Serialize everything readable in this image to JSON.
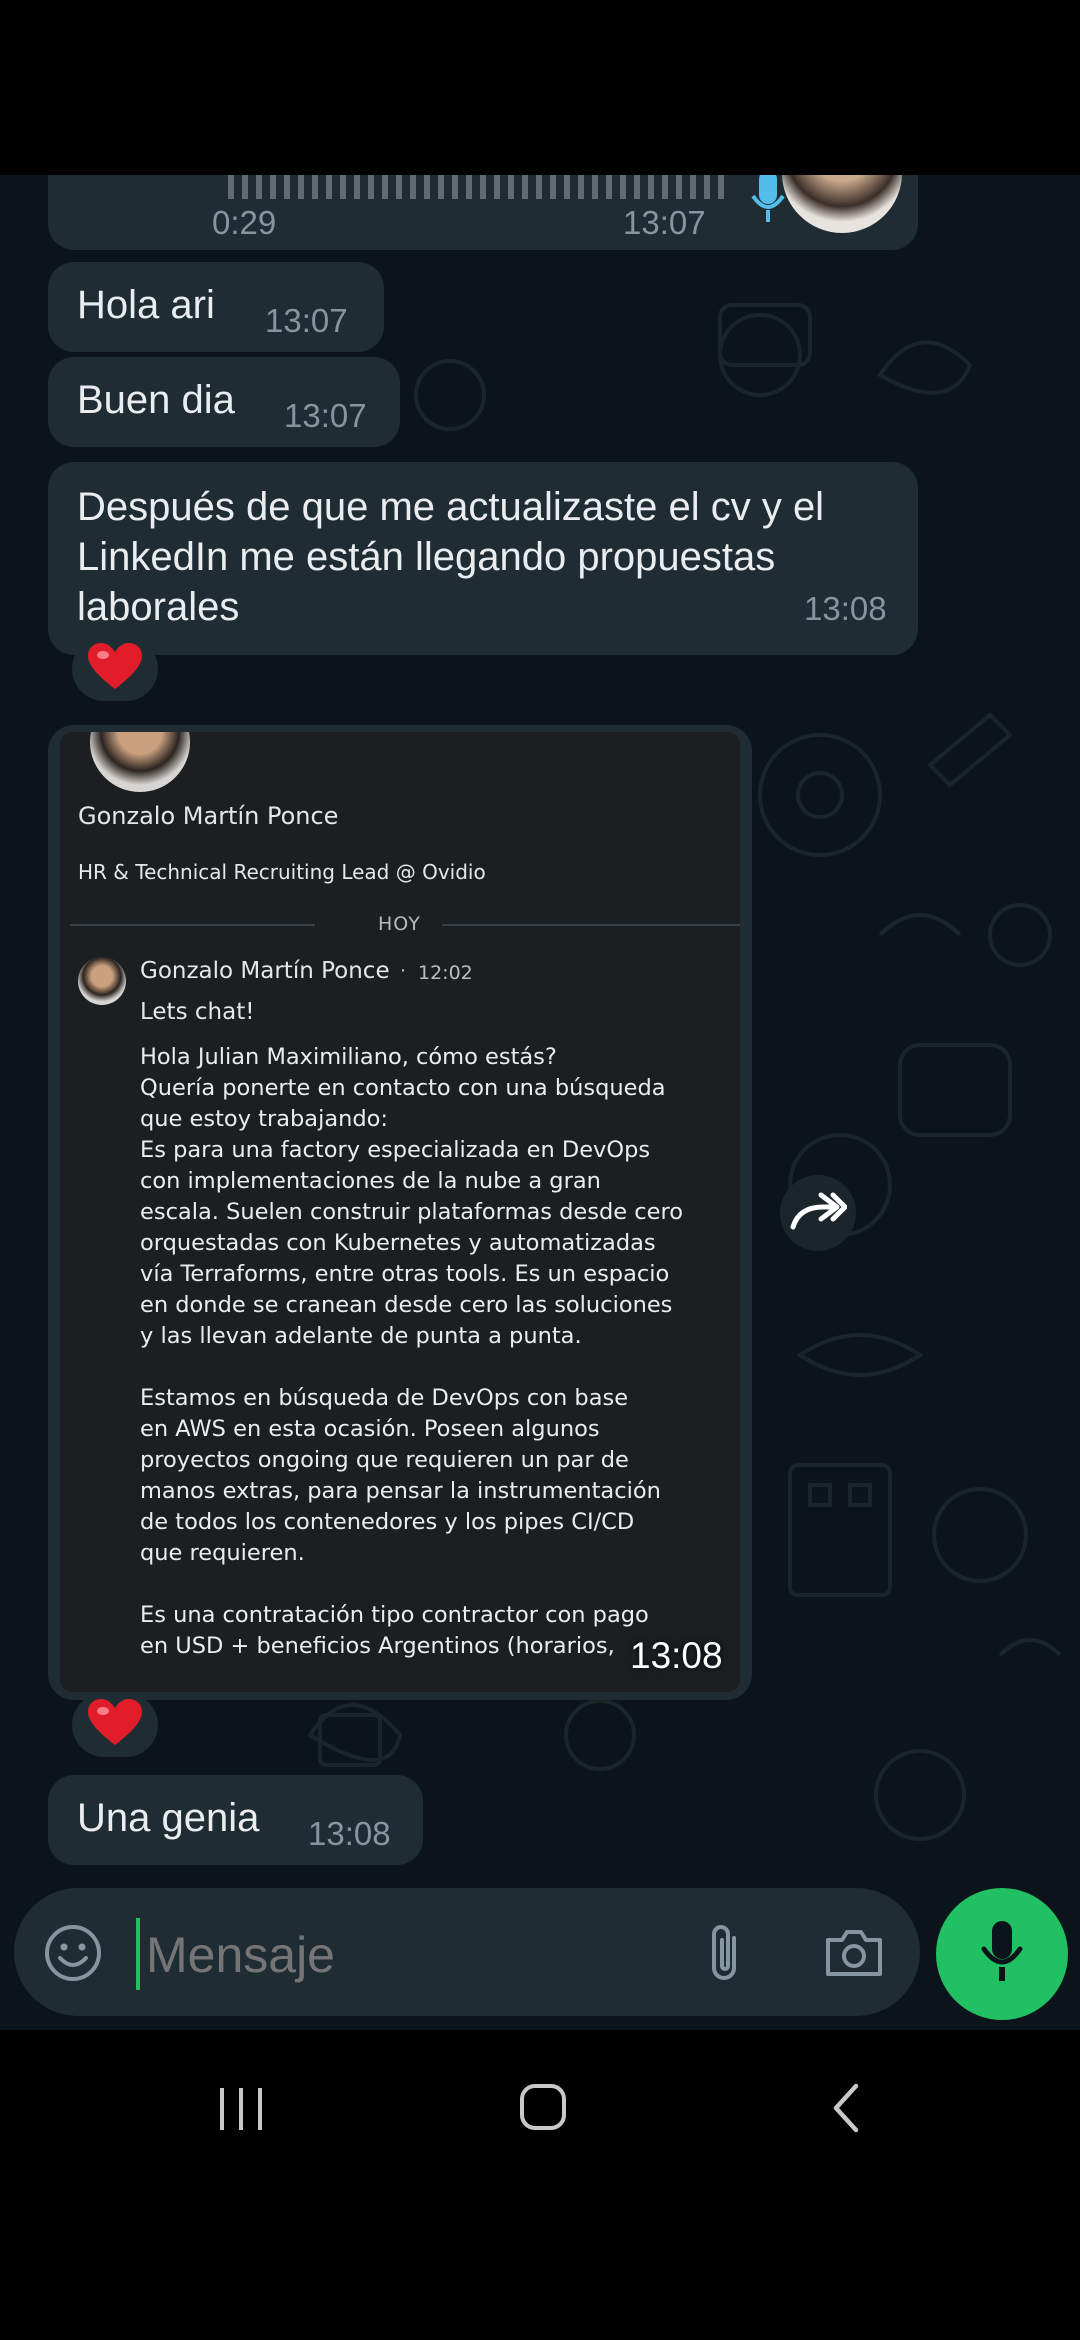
{
  "top_voice_note": {
    "duration": "0:29",
    "time": "13:07"
  },
  "messages": [
    {
      "text": "Hola ari",
      "time": "13:07"
    },
    {
      "text": "Buen dia",
      "time": "13:07"
    },
    {
      "lines": [
        "Después de que me actualizaste el cv y el",
        "LinkedIn me están llegando propuestas",
        "laborales"
      ],
      "time": "13:08",
      "reaction": "❤️"
    }
  ],
  "image_message": {
    "time": "13:08",
    "reaction": "❤️",
    "card": {
      "profile_name": "Gonzalo Martín Ponce",
      "profile_title": "HR & Technical Recruiting Lead @ Ovidio",
      "day_divider": "HOY",
      "sender": "Gonzalo Martín Ponce",
      "sender_sep": "·",
      "sender_time": "12:02",
      "subject": "Lets chat!",
      "body": [
        "Hola Julian Maximiliano, cómo estás?",
        "Quería ponerte en contacto con una búsqueda",
        "que estoy trabajando:",
        "Es para una factory especializada en DevOps",
        "con implementaciones de la nube a gran",
        "escala. Suelen construir plataformas desde cero",
        "orquestadas con Kubernetes y automatizadas",
        "vía Terraforms, entre otras tools. Es un espacio",
        "en donde se cranean desde cero las soluciones",
        "y las llevan adelante de punta a punta.",
        "",
        "Estamos en búsqueda de DevOps con base",
        "en AWS en esta ocasión. Poseen algunos",
        "proyectos ongoing que requieren un par de",
        "manos extras, para pensar la instrumentación",
        "de todos los contenedores y los pipes CI/CD",
        "que requieren.",
        "",
        "Es una contratación tipo contractor con pago",
        "en USD + beneficios Argentinos (horarios,"
      ]
    }
  },
  "last_message": {
    "text": "Una genia",
    "time": "13:08"
  },
  "input": {
    "placeholder": "Mensaje"
  },
  "colors": {
    "chat_bg": "#0b141a",
    "bubble": "#1f2c34",
    "accent_green": "#21c063",
    "mic_blue": "#53bdeb",
    "time_gray": "#8696a0"
  },
  "icons": [
    "mic-icon",
    "heart-icon",
    "forward-icon",
    "emoji-icon",
    "attach-icon",
    "camera-icon",
    "recents-icon",
    "home-icon",
    "back-icon"
  ]
}
